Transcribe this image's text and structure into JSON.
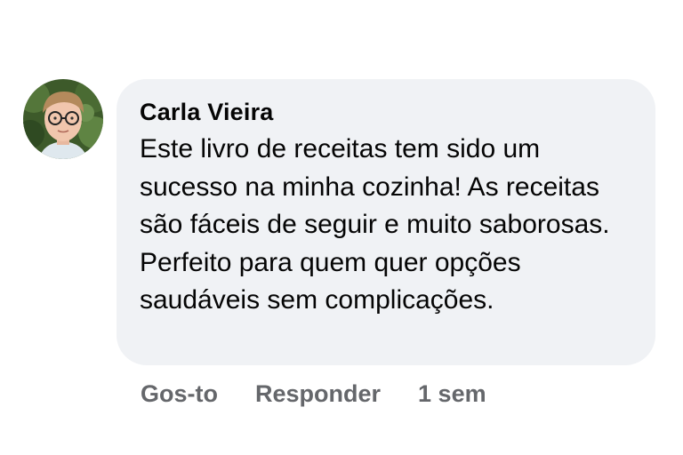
{
  "comment": {
    "author": "Carla Vieira",
    "avatar_icon": "user-avatar-photo",
    "text": "Este livro de receitas tem sido um sucesso na minha cozinha! As receitas são fáceis de seguir e muito saborosas. Perfeito para quem quer opções saudáveis sem complicações."
  },
  "actions": {
    "like_label": "Gos-to",
    "reply_label": "Responder",
    "timestamp": "1 sem"
  },
  "colors": {
    "bubble_bg": "#f0f2f5",
    "text": "#050505",
    "secondary": "#65676b"
  }
}
